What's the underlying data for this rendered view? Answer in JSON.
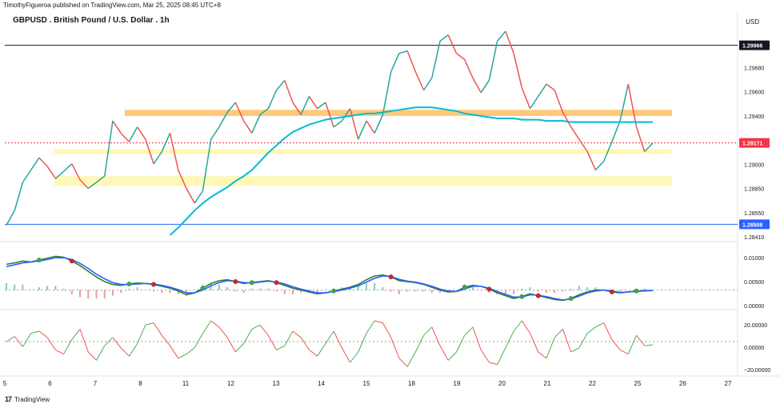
{
  "header": {
    "publisher": "TimothyFigueroa published on TradingView.com, Mar 25, 2025 08:45 UTC+8",
    "title": "GBPUSD . British Pound / U.S. Dollar . 1h",
    "currency": "USD"
  },
  "footer": {
    "brand": "TradingView",
    "logo_glyph": "17"
  },
  "chart_data": [
    {
      "type": "line",
      "pane": "price",
      "y_ticks": [
        "1.29900",
        "1.29680",
        "1.29600",
        "1.29400",
        "1.29200",
        "1.29000",
        "1.28850",
        "1.28550",
        "1.28410"
      ],
      "ylim": [
        1.2838,
        1.301
      ],
      "x_ticks": [
        "5",
        "6",
        "7",
        "8",
        "11",
        "12",
        "13",
        "14",
        "15",
        "18",
        "19",
        "20",
        "21",
        "22",
        "25",
        "26",
        "27"
      ],
      "price_labels": [
        {
          "value": "1.29966",
          "color": "#131722"
        },
        {
          "value": "1.29171",
          "color": "#f23645"
        },
        {
          "value": "1.28508",
          "color": "#2962ff"
        }
      ],
      "horizontal_lines": [
        {
          "price": 1.29966,
          "color": "#131722"
        },
        {
          "price": 1.28508,
          "color": "#2962ff"
        },
        {
          "price": 1.29171,
          "color": "#f23645",
          "style": "dotted"
        }
      ],
      "zones": [
        {
          "low": 1.2939,
          "high": 1.2944,
          "color": "#ffb74d"
        },
        {
          "low": 1.2908,
          "high": 1.2912,
          "color": "#fff59d"
        },
        {
          "low": 1.2882,
          "high": 1.289,
          "color": "#fff59d"
        }
      ],
      "series": [
        {
          "values": [
            1.285,
            1.2862,
            1.2885,
            1.2895,
            1.2905,
            1.2898,
            1.2888,
            1.2894,
            1.29,
            1.2887,
            1.288,
            1.2885,
            1.289,
            1.2935,
            1.2925,
            1.2918,
            1.293,
            1.292,
            1.29,
            1.291,
            1.2925,
            1.2895,
            1.288,
            1.2868,
            1.2878,
            1.292,
            1.293,
            1.2942,
            1.295,
            1.2935,
            1.2925,
            1.294,
            1.2945,
            1.296,
            1.2968,
            1.295,
            1.294,
            1.2955,
            1.2945,
            1.295,
            1.293,
            1.2935,
            1.2945,
            1.292,
            1.2935,
            1.2925,
            1.294,
            1.2975,
            1.299,
            1.2992,
            1.2975,
            1.296,
            1.297,
            1.3,
            1.3005,
            1.299,
            1.2985,
            1.297,
            1.2958,
            1.2968,
            1.3,
            1.3008,
            1.299,
            1.2962,
            1.2945,
            1.2955,
            1.2965,
            1.296,
            1.2942,
            1.293,
            1.292,
            1.291,
            1.2895,
            1.2902,
            1.2918,
            1.2935,
            1.2965,
            1.293,
            1.291,
            1.2917
          ],
          "color": "#26a69a"
        },
        {
          "name": "",
          "values": [
            null,
            null,
            null,
            null,
            null,
            null,
            null,
            null,
            null,
            null,
            null,
            null,
            null,
            null,
            null,
            null,
            null,
            null,
            null,
            null,
            1.2842,
            1.2848,
            1.2855,
            1.2862,
            1.2868,
            1.2873,
            1.2877,
            1.2881,
            1.2886,
            1.289,
            1.2895,
            1.2902,
            1.2909,
            1.2915,
            1.2921,
            1.2926,
            1.2929,
            1.2932,
            1.2934,
            1.2936,
            1.2937,
            1.2938,
            1.2939,
            1.294,
            1.2941,
            1.2941,
            1.2942,
            1.2943,
            1.2944,
            1.2945,
            1.2946,
            1.2946,
            1.2946,
            1.2945,
            1.2944,
            1.2943,
            1.2941,
            1.294,
            1.2939,
            1.2938,
            1.2937,
            1.2937,
            1.2937,
            1.2936,
            1.2936,
            1.2936,
            1.2935,
            1.2935,
            1.2935,
            1.2934,
            1.2934,
            1.2934,
            1.2934,
            1.2934,
            1.2934,
            1.2934,
            1.2934,
            1.2934,
            1.2934,
            1.2934
          ],
          "color": "#00bcd4"
        }
      ]
    },
    {
      "type": "line",
      "pane": "oscillator",
      "y_ticks": [
        "0.01000",
        "0.00500",
        "0.00000"
      ],
      "ylim": [
        -0.004,
        0.01
      ],
      "series": [
        {
          "values": [
            0.0055,
            0.0058,
            0.0062,
            0.006,
            0.0064,
            0.0068,
            0.0072,
            0.007,
            0.0062,
            0.0052,
            0.004,
            0.0028,
            0.0018,
            0.0012,
            0.001,
            0.0013,
            0.0015,
            0.0014,
            0.0012,
            0.0008,
            0.0004,
            -0.0002,
            -0.001,
            -0.0006,
            0.0004,
            0.0014,
            0.002,
            0.0022,
            0.0018,
            0.0014,
            0.0016,
            0.0018,
            0.002,
            0.0016,
            0.001,
            0.0004,
            0.0,
            -0.0004,
            -0.0008,
            -0.0006,
            -0.0002,
            0.0002,
            0.0006,
            0.0012,
            0.0022,
            0.003,
            0.0032,
            0.0028,
            0.002,
            0.0018,
            0.0016,
            0.0012,
            0.0006,
            0.0,
            -0.0004,
            -0.0003,
            0.0006,
            0.001,
            0.0008,
            0.0002,
            -0.0006,
            -0.0012,
            -0.0018,
            -0.0014,
            -0.0008,
            -0.0012,
            -0.0016,
            -0.002,
            -0.0022,
            -0.0018,
            -0.001,
            -0.0004,
            0.0,
            0.0,
            -0.0004,
            -0.0006,
            -0.0004,
            -0.0002,
            -0.0001,
            -0.0001
          ],
          "color": "#2e7d32"
        },
        {
          "values": [
            0.005,
            0.0054,
            0.0058,
            0.006,
            0.0062,
            0.0065,
            0.0069,
            0.0069,
            0.0065,
            0.0057,
            0.0046,
            0.0034,
            0.0024,
            0.0016,
            0.0012,
            0.0012,
            0.0013,
            0.0014,
            0.0013,
            0.001,
            0.0006,
            0.0001,
            -0.0006,
            -0.0006,
            0.0,
            0.0009,
            0.0016,
            0.002,
            0.0019,
            0.0016,
            0.0015,
            0.0017,
            0.0019,
            0.0017,
            0.0013,
            0.0007,
            0.0002,
            -0.0002,
            -0.0006,
            -0.0006,
            -0.0003,
            0.0,
            0.0004,
            0.0009,
            0.0017,
            0.0025,
            0.003,
            0.0029,
            0.0023,
            0.0019,
            0.0017,
            0.0013,
            0.0008,
            0.0002,
            -0.0002,
            -0.0003,
            0.0002,
            0.0008,
            0.0008,
            0.0004,
            -0.0003,
            -0.0009,
            -0.0015,
            -0.0015,
            -0.001,
            -0.0011,
            -0.0014,
            -0.0018,
            -0.0021,
            -0.0019,
            -0.0013,
            -0.0006,
            -0.0002,
            0.0,
            -0.0002,
            -0.0005,
            -0.0004,
            -0.0003,
            -0.0002,
            -0.0001
          ],
          "color": "#2962ff"
        }
      ]
    },
    {
      "type": "line",
      "pane": "momentum",
      "y_ticks": [
        "20.00000",
        "0.00000",
        "−20.00000"
      ],
      "ylim": [
        -30,
        30
      ],
      "series": [
        {
          "values": [
            0,
            5,
            -5,
            8,
            10,
            4,
            -8,
            -12,
            2,
            12,
            -10,
            -18,
            -4,
            4,
            -6,
            -14,
            -2,
            16,
            18,
            6,
            -4,
            -16,
            -12,
            -6,
            8,
            20,
            14,
            4,
            -10,
            -2,
            12,
            16,
            6,
            -8,
            -4,
            10,
            4,
            -8,
            -14,
            -2,
            10,
            -6,
            -20,
            -10,
            8,
            20,
            18,
            4,
            -16,
            -24,
            -10,
            6,
            14,
            -4,
            -18,
            -10,
            6,
            14,
            -8,
            -20,
            -22,
            -6,
            10,
            20,
            8,
            -10,
            -16,
            4,
            12,
            -10,
            -6,
            8,
            14,
            18,
            2,
            -8,
            -12,
            6,
            -4,
            -3
          ],
          "color": "#4caf50"
        }
      ]
    }
  ]
}
